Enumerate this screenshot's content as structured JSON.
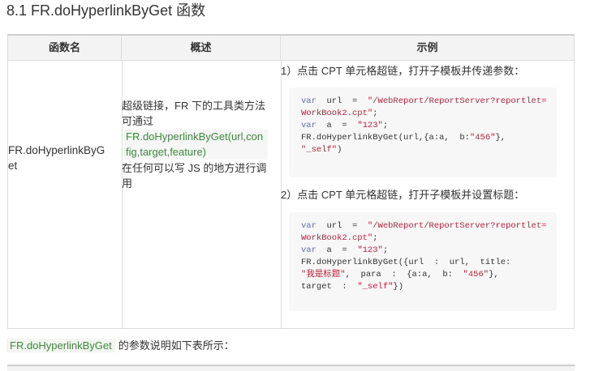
{
  "section": {
    "title": "8.1 FR.doHyperlinkByGet 函数"
  },
  "table": {
    "headers": [
      "函数名",
      "概述",
      "示例"
    ],
    "row": {
      "func_name": "FR.doHyperlinkByGet",
      "desc_1": "超级链接，FR 下的工具类方法",
      "desc_2": "可通过",
      "desc_code": "FR.doHyperlinkByGet(url,config,target,feature)",
      "desc_3": "在任何可以写 JS 的地方进行调用",
      "example_1_label": "1）点击 CPT 单元格超链，打开子模板并传递参数：",
      "example_1_code": {
        "l1_kw": "var",
        "l1_mid": "  url  =  ",
        "l1_str": "\"/WebReport/ReportServer?reportlet=WorkBook2.cpt\"",
        "l1_end": ";",
        "l2_kw": "var",
        "l2_mid": "  a  =  ",
        "l2_str": "\"123\"",
        "l2_end": ";",
        "l3": "FR.doHyperlinkByGet(url,{a:a,  b:",
        "l3_str": "\"456\"",
        "l3_end": "},",
        "l4_str": "\"_self\"",
        "l4_end": ")"
      },
      "example_2_label": "2）点击 CPT 单元格超链，打开子模板并设置标题：",
      "example_2_code": {
        "l1_kw": "var",
        "l1_mid": "  url  =  ",
        "l1_str": "\"/WebReport/ReportServer?reportlet=WorkBook2.cpt\"",
        "l1_end": ";",
        "l2_kw": "var",
        "l2_mid": "  a  =  ",
        "l2_str": "\"123\"",
        "l2_end": ";",
        "l3": "FR.doHyperlinkByGet({url  :  url,  title:",
        "l4_str": "\"我是标题\"",
        "l4_mid": ",  para  :  {a:a,  b:  ",
        "l4_str2": "\"456\"",
        "l4_end": "},",
        "l5": "target  :  ",
        "l5_str": "\"_self\"",
        "l5_end": "})"
      }
    }
  },
  "footer": {
    "code": "FR.doHyperlinkByGet",
    "text": "的参数说明如下表所示："
  }
}
